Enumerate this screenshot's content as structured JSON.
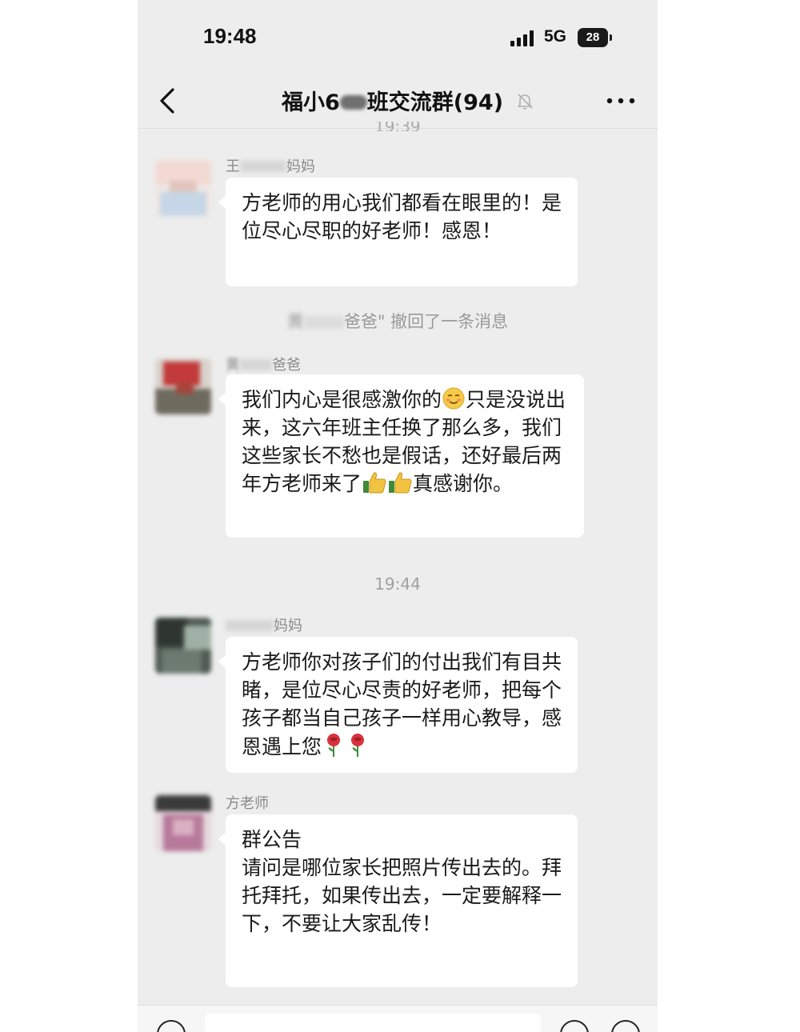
{
  "status_bar": {
    "time": "19:48",
    "network": "5G",
    "battery": "28"
  },
  "header": {
    "title": "福小6",
    "title_suffix": "班交流群(94)"
  },
  "messages": [
    {
      "sender": "王",
      "sender_suffix": "妈妈",
      "text": "方老师的用心我们都看在眼里的！是位尽心尽职的好老师！感恩！"
    },
    {
      "sender": "黄",
      "sender_suffix": "爸爸",
      "text_parts": [
        "我们内心是很感激你的",
        "只是没说出来，这六年班主任换了那么多，我们这些家长不愁也是假话，还好最后两年方老师来了",
        "真感谢你。"
      ],
      "emoji": [
        "shy-face-emoji",
        "thumbs-up-emoji",
        "thumbs-up-emoji"
      ]
    },
    {
      "sender_suffix": "妈妈",
      "text": "方老师你对孩子们的付出我们有目共睹，是位尽心尽责的好老师，把每个孩子都当自己孩子一样用心教导，感恩遇上您",
      "emoji": [
        "rose-emoji",
        "rose-emoji"
      ]
    },
    {
      "sender": "方老师",
      "heading": "群公告",
      "text": "请问是哪位家长把照片传出去的。拜托拜托，如果传出去，一定要解释一下，不要让大家乱传！"
    }
  ],
  "system_notice": {
    "prefix": "黄",
    "text": "爸爸\" 撤回了一条消息"
  },
  "timestamps": {
    "top_partial": "19:39",
    "mid": "19:44"
  },
  "colors": {
    "chat_background": "#ededed",
    "bubble": "#ffffff",
    "meta_text": "#9a9a9a"
  },
  "icons": {
    "back": "chevron-left-icon",
    "mute": "bell-off-icon",
    "more": "more-dots-icon"
  }
}
